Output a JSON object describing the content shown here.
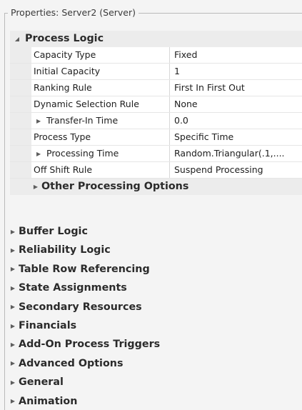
{
  "panel": {
    "title": "Properties: Server2 (Server)"
  },
  "icons": {
    "expanded": "triangle-down-right-icon",
    "collapsed": "triangle-right-icon"
  },
  "process_logic": {
    "label": "Process Logic",
    "rows": [
      {
        "name": "Capacity Type",
        "value": "Fixed"
      },
      {
        "name": "Initial Capacity",
        "value": "1"
      },
      {
        "name": "Ranking Rule",
        "value": "First In First Out"
      },
      {
        "name": "Dynamic Selection Rule",
        "value": "None"
      },
      {
        "name": "Transfer-In Time",
        "value": "0.0"
      },
      {
        "name": "Process Type",
        "value": "Specific Time"
      },
      {
        "name": "Processing Time",
        "value": "Random.Triangular(.1,...."
      },
      {
        "name": "Off Shift Rule",
        "value": "Suspend Processing"
      }
    ],
    "sub_category": "Other Processing Options"
  },
  "categories": [
    "Buffer Logic",
    "Reliability Logic",
    "Table Row Referencing",
    "State Assignments",
    "Secondary Resources",
    "Financials",
    "Add-On Process Triggers",
    "Advanced Options",
    "General",
    "Animation"
  ]
}
